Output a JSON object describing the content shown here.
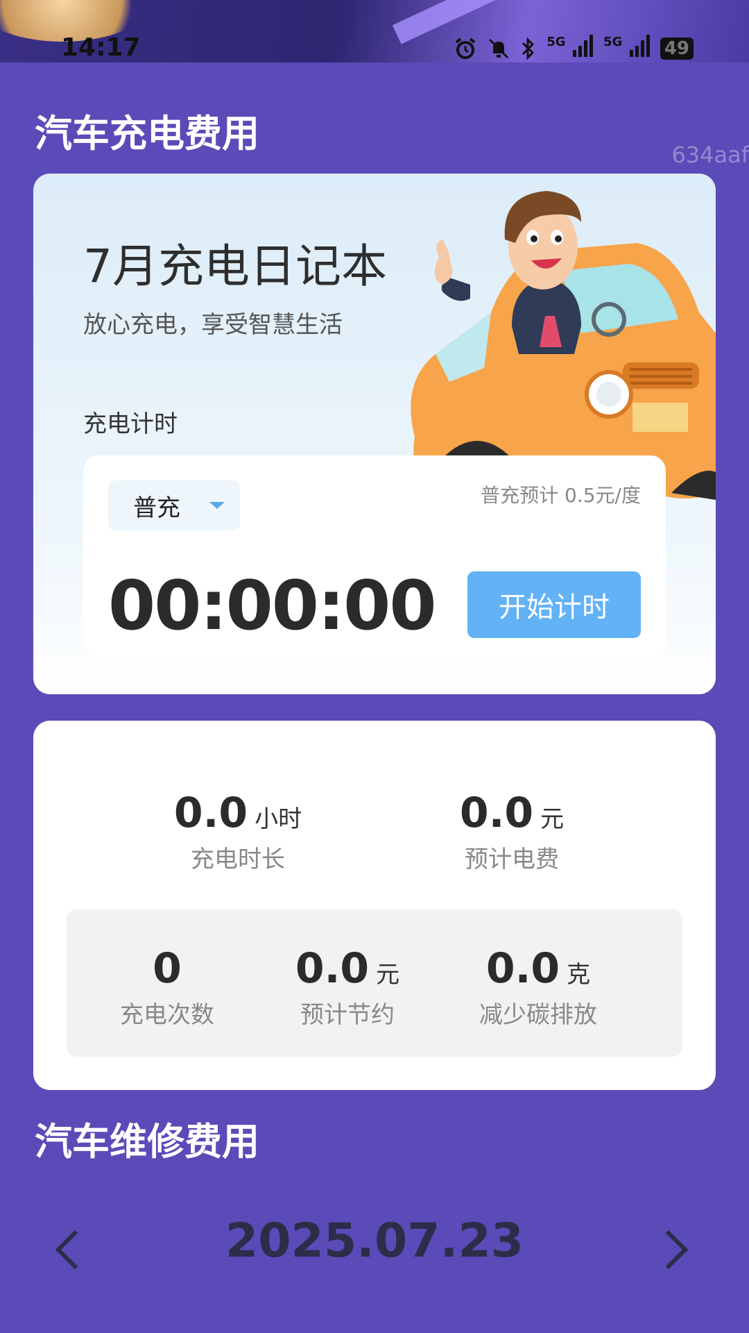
{
  "status_bar": {
    "time": "14:17",
    "net1": "5G",
    "net2": "5G",
    "battery": "49",
    "icons": [
      "alarm-icon",
      "mute-icon",
      "bluetooth-icon",
      "signal-5g-icon",
      "signal-5g-icon",
      "battery-icon"
    ]
  },
  "watermark": "634aaf",
  "charging_section": {
    "title": "汽车充电费用",
    "card": {
      "title": "7月充电日记本",
      "subtitle": "放心充电，享受智慧生活",
      "timer_label": "充电计时",
      "mode": "普充",
      "rate_hint": "普充预计 0.5元/度",
      "timer_value": "00:00:00",
      "start_button": "开始计时"
    },
    "stats": {
      "duration": {
        "value": "0.0",
        "unit": "小时",
        "label": "充电时长"
      },
      "cost": {
        "value": "0.0",
        "unit": "元",
        "label": "预计电费"
      },
      "count": {
        "value": "0",
        "unit": "",
        "label": "充电次数"
      },
      "savings": {
        "value": "0.0",
        "unit": "元",
        "label": "预计节约"
      },
      "carbon": {
        "value": "0.0",
        "unit": "克",
        "label": "减少碳排放"
      }
    }
  },
  "repair_section": {
    "title": "汽车维修费用",
    "date": "2025.07.23"
  },
  "colors": {
    "background": "#5a4bb8",
    "accent_button": "#62b2f5",
    "card": "#ffffff"
  }
}
